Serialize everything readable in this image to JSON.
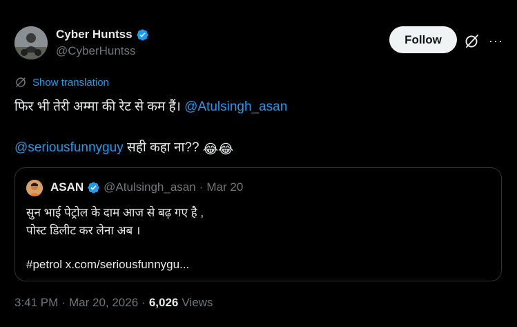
{
  "author": {
    "name": "Cyber Huntss",
    "handle": "@CyberHuntss"
  },
  "header": {
    "follow_label": "Follow",
    "more_label": "···"
  },
  "translation": {
    "label": "Show translation"
  },
  "tweet": {
    "line1_text": "फिर भी तेरी अम्मा की रेट से कम हैं। ",
    "line1_mention": "@Atulsingh_asan",
    "line2_mention": "@seriousfunnyguy",
    "line2_text": " सही कहा ना?? ",
    "line2_emoji": "😂😂"
  },
  "quote": {
    "name": "ASAN",
    "handle": "@Atulsingh_asan",
    "separator": "·",
    "date": "Mar 20",
    "line1": "सुन भाई पेट्रोल के दाम आज से बढ़ गए है ,",
    "line2": "पोस्ट डिलीट कर लेना अब ।",
    "line3": "#petrol x.com/seriousfunnygu..."
  },
  "footer": {
    "time": "3:41 PM",
    "sep1": "·",
    "date": "Mar 20, 2026",
    "sep2": "·",
    "views_count": "6,026",
    "views_label": "Views"
  },
  "colors": {
    "background": "#000000",
    "text": "#e7e9ea",
    "secondary": "#71767b",
    "accent": "#1d9bf0",
    "border": "#2f3336",
    "follow_bg": "#eff3f4"
  },
  "icons": [
    "verified-badge-icon",
    "grok-icon",
    "more-icon",
    "translate-icon"
  ]
}
